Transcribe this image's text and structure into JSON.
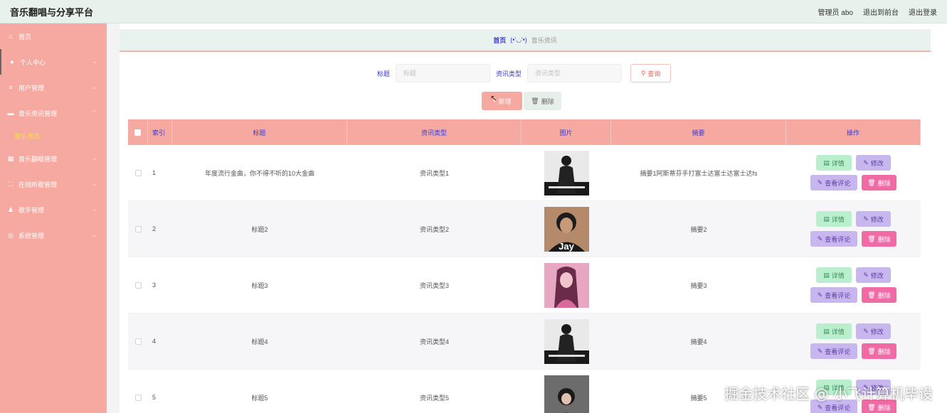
{
  "app": {
    "title": "音乐翻唱与分享平台"
  },
  "topbar": {
    "user": "管理员 abo",
    "to_front": "退出到前台",
    "logout": "退出登录"
  },
  "sidebar": {
    "items": [
      {
        "label": "首页",
        "icon": "home-icon"
      },
      {
        "label": "个人中心",
        "icon": "user-icon"
      },
      {
        "label": "用户管理",
        "icon": "list-icon"
      },
      {
        "label": "音乐资讯管理",
        "icon": "news-icon"
      },
      {
        "label": "音乐翻唱管理",
        "icon": "grid-icon"
      },
      {
        "label": "在线听歌管理",
        "icon": "frame-icon"
      },
      {
        "label": "歌手管理",
        "icon": "person-icon"
      },
      {
        "label": "系统管理",
        "icon": "gear-icon"
      }
    ],
    "sub": {
      "label": "音乐资讯"
    }
  },
  "breadcrumb": {
    "home": "首页",
    "face": "(•'◡'•)",
    "current": "音乐资讯"
  },
  "search": {
    "title_label": "标题",
    "title_placeholder": "标题",
    "type_label": "资讯类型",
    "type_placeholder": "资讯类型",
    "query_button": "查询"
  },
  "actions": {
    "add": "新增",
    "delete": "删除"
  },
  "table": {
    "headers": {
      "index": "索引",
      "title": "标题",
      "type": "资讯类型",
      "image": "图片",
      "summary": "摘要",
      "ops": "操作"
    },
    "op_labels": {
      "detail": "详情",
      "edit": "修改",
      "comment": "查看评论",
      "delete": "删除"
    },
    "rows": [
      {
        "index": "1",
        "title": "年度流行金曲，你不得不听的10大金曲",
        "type": "资讯类型1",
        "summary": "摘要1阿斯蒂芬手打富士达富士达富士达fs"
      },
      {
        "index": "2",
        "title": "标题2",
        "type": "资讯类型2",
        "summary": "摘要2"
      },
      {
        "index": "3",
        "title": "标题3",
        "type": "资讯类型3",
        "summary": "摘要3"
      },
      {
        "index": "4",
        "title": "标题4",
        "type": "资讯类型4",
        "summary": "摘要4"
      },
      {
        "index": "5",
        "title": "标题5",
        "type": "资讯类型5",
        "summary": "摘要5"
      }
    ]
  },
  "watermark": "掘金技术社区 @ 小飞计算机毕设",
  "colors": {
    "sidebar": "#f6a9a0",
    "accent_text": "#3a3ad0",
    "detail": "#b9efcc",
    "edit": "#c8b6ee",
    "delete": "#f06aa5"
  }
}
